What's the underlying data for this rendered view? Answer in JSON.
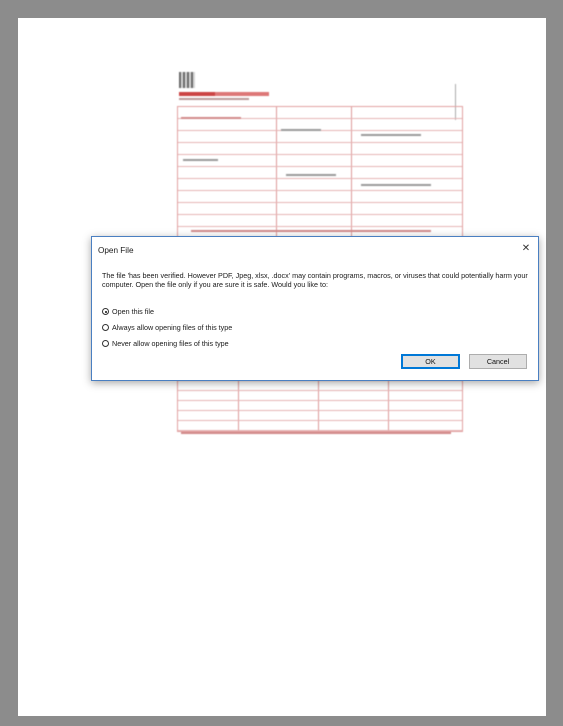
{
  "dialog": {
    "title": "Open File",
    "close_glyph": "✕",
    "message": "The file 'has been verified. However PDF, Jpeg, xlsx, .docx' may contain programs, macros, or viruses that could potentially harm your computer. Open the file only if you are sure it is safe. Would you like to:",
    "options": [
      {
        "label": "Open this file",
        "selected": true
      },
      {
        "label": "Always allow opening files of this type",
        "selected": false
      },
      {
        "label": "Never allow opening files of this type",
        "selected": false
      }
    ],
    "ok_label": "OK",
    "cancel_label": "Cancel"
  },
  "icons": {
    "close": "close-icon",
    "qr": "qr-code-icon"
  },
  "colors": {
    "background": "#8c8c8c",
    "page": "#ffffff",
    "dialog_border": "#4a7fc1",
    "button_focus": "#0078d7",
    "form_red": "#d28a8a"
  }
}
